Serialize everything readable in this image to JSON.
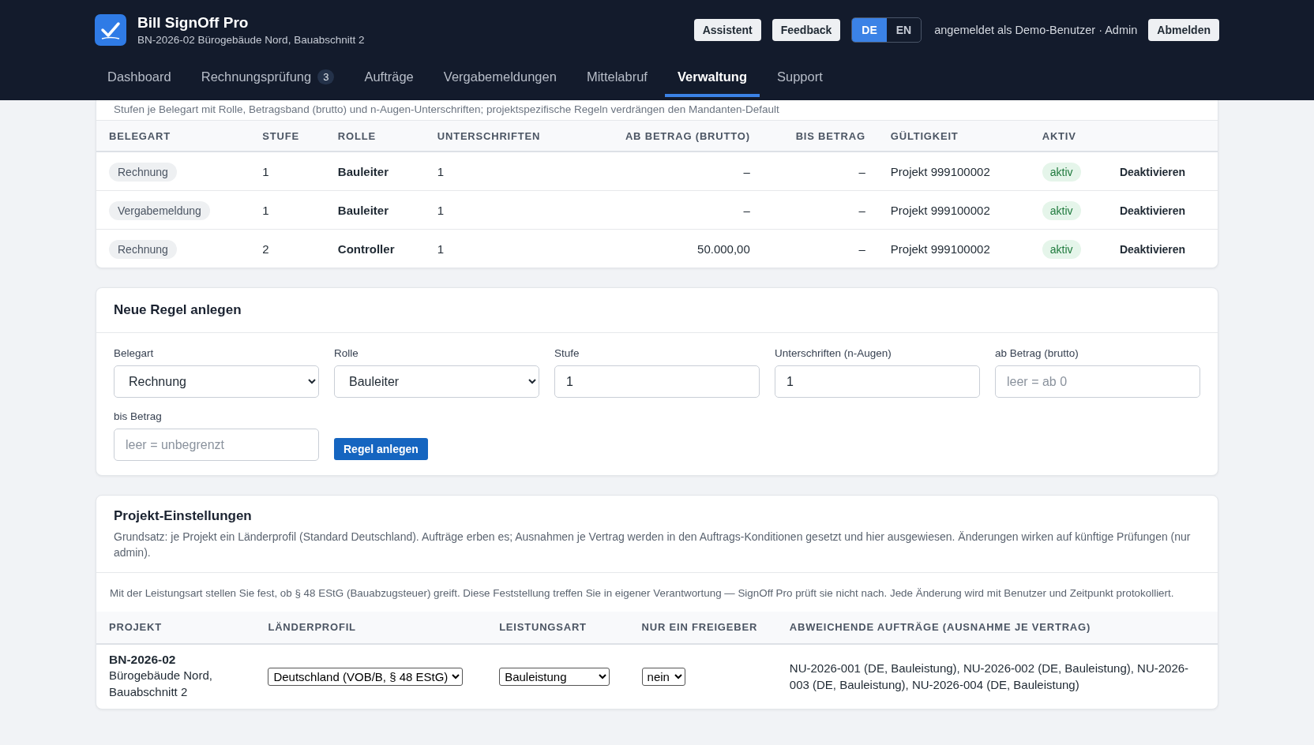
{
  "header": {
    "title": "Bill SignOff Pro",
    "subtitle": "BN-2026-02 Bürogebäude Nord, Bauabschnitt 2",
    "buttons": [
      "Assistent",
      "Feedback"
    ],
    "languages": [
      {
        "label": "DE",
        "selected": true
      },
      {
        "label": "EN",
        "selected": false
      }
    ],
    "user": "angemeldet als Demo-Benutzer · Admin",
    "logout": "Abmelden"
  },
  "nav": [
    {
      "label": "Dashboard",
      "selected": false
    },
    {
      "label": "Rechnungsprüfung",
      "badge": "3",
      "selected": false
    },
    {
      "label": "Aufträge",
      "selected": false
    },
    {
      "label": "Vergabemeldungen",
      "selected": false
    },
    {
      "label": "Mittelabruf",
      "selected": false
    },
    {
      "label": "Verwaltung",
      "selected": true
    },
    {
      "label": "Support",
      "selected": false
    }
  ],
  "rules": {
    "intro": "Stufen je Belegart mit Rolle, Betragsband (brutto) und n-Augen-Unterschriften; projektspezifische Regeln verdrängen den Mandanten-Default",
    "columns": [
      "BELEGART",
      "STUFE",
      "ROLLE",
      "UNTERSCHRIFTEN",
      "AB BETRAG (BRUTTO)",
      "BIS BETRAG",
      "GÜLTIGKEIT",
      "AKTIV"
    ],
    "rows": [
      {
        "belegart": "Rechnung",
        "stufe": "1",
        "rolle": "Bauleiter",
        "unterschriften": "1",
        "ab_betrag": "–",
        "bis_betrag": "–",
        "gueltigkeit": "Projekt 999100002",
        "status": {
          "kind": "active",
          "label": "aktiv"
        },
        "action": "Deaktivieren"
      },
      {
        "belegart": "Vergabemeldung",
        "stufe": "1",
        "rolle": "Bauleiter",
        "unterschriften": "1",
        "ab_betrag": "–",
        "bis_betrag": "–",
        "gueltigkeit": "Projekt 999100002",
        "status": {
          "kind": "active",
          "label": "aktiv"
        },
        "action": "Deaktivieren"
      },
      {
        "belegart": "Rechnung",
        "stufe": "2",
        "rolle": "Controller",
        "unterschriften": "1",
        "ab_betrag": "50.000,00",
        "bis_betrag": "–",
        "gueltigkeit": "Projekt 999100002",
        "status": {
          "kind": "active",
          "label": "aktiv"
        },
        "action": "Deaktivieren"
      }
    ]
  },
  "new_rule": {
    "title": "Neue Regel anlegen",
    "fields": [
      {
        "kind": "select",
        "label": "Belegart",
        "value": "Rechnung"
      },
      {
        "kind": "select",
        "label": "Rolle",
        "value": "Bauleiter"
      },
      {
        "kind": "input",
        "label": "Stufe",
        "value": "1"
      },
      {
        "kind": "input",
        "label": "Unterschriften (n-Augen)",
        "value": "1"
      },
      {
        "kind": "input",
        "label": "ab Betrag (brutto)",
        "placeholder": "leer = ab 0"
      },
      {
        "kind": "input",
        "label": "bis Betrag",
        "placeholder": "leer = unbegrenzt"
      }
    ],
    "submit": "Regel anlegen"
  },
  "project_settings": {
    "title": "Projekt-Einstellungen",
    "description": "Grundsatz: je Projekt ein Länderprofil (Standard Deutschland). Aufträge erben es; Ausnahmen je Vertrag werden in den Auftrags-Konditionen gesetzt und hier ausgewiesen. Änderungen wirken auf künftige Prüfungen (nur admin).",
    "note": "Mit der Leistungsart stellen Sie fest, ob § 48 EStG (Bauabzugsteuer) greift. Diese Feststellung treffen Sie in eigener Verantwortung — SignOff Pro prüft sie nicht nach. Jede Änderung wird mit Benutzer und Zeitpunkt protokolliert.",
    "columns": [
      "PROJEKT",
      "LÄNDERPROFIL",
      "LEISTUNGSART",
      "NUR EIN FREIGEBER",
      "ABWEICHENDE AUFTRÄGE (AUSNAHME JE VERTRAG)"
    ],
    "rows": [
      {
        "project_id": "BN-2026-02",
        "project_name": "Bürogebäude Nord, Bauabschnitt 2",
        "laenderprofil": "Deutschland (VOB/B, § 48 EStG)",
        "leistungsart": "Bauleistung",
        "nur_ein_freigeber": "nein",
        "abweichende": "NU-2026-001 (DE, Bauleistung), NU-2026-002 (DE, Bauleistung), NU-2026-003 (DE, Bauleistung), NU-2026-004 (DE, Bauleistung)"
      }
    ]
  }
}
